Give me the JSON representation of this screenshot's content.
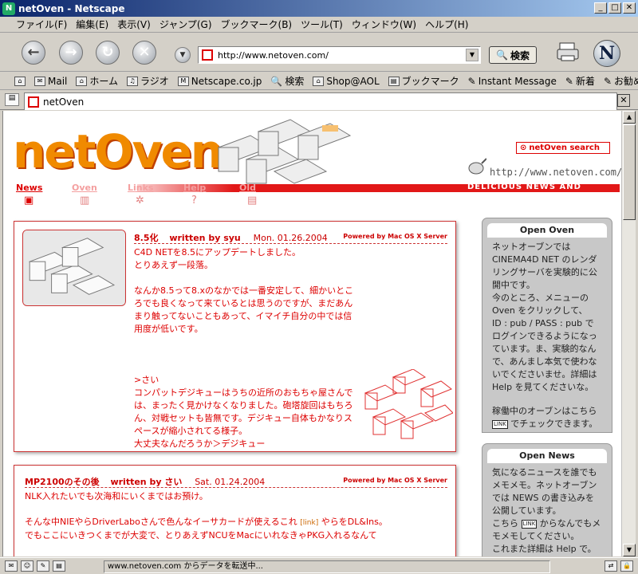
{
  "window": {
    "title": "netOven - Netscape"
  },
  "menubar": [
    "ファイル(F)",
    "編集(E)",
    "表示(V)",
    "ジャンプ(G)",
    "ブックマーク(B)",
    "ツール(T)",
    "ウィンドウ(W)",
    "ヘルプ(H)"
  ],
  "navbar": {
    "url": "http://www.netoven.com/",
    "search_label": "検索"
  },
  "personal_toolbar": [
    "Mail",
    "ホーム",
    "ラジオ",
    "Netscape.co.jp",
    "検索",
    "Shop@AOL",
    "ブックマーク",
    "Instant Message",
    "新着",
    "お勧め"
  ],
  "tab": {
    "label": "netOven"
  },
  "site": {
    "logo": "netOven",
    "search_label": "netOven search",
    "url_text": "http://www.netoven.com/",
    "tagline": "DELICIOUS NEWS AND RENDERING",
    "nav": [
      "News",
      "Oven",
      "Links",
      "Help",
      "Old"
    ]
  },
  "posts": [
    {
      "title": "8.5化",
      "author": "written by syu",
      "date": "Mon. 01.26.2004",
      "powered": "Powered by Mac OS X Server",
      "paragraphs": [
        "C4D NETを8.5にアップデートしました。\nとりあえず一段落。",
        "なんか8.5って8.xのなかでは一番安定して、細かいところでも良くなって来ているとは思うのですが、まだあんまり触ってないこともあって、イマイチ自分の中では信用度が低いです。",
        "",
        ">さい\nコンパットデジキューはうちの近所のおもちゃ屋さんでは、まったく見かけなくなりました。砲塔旋回はもちろん、対戦セットも皆無です。デジキュー自体もかなりスペースが縮小されてる様子。\n大丈夫なんだろうか＞デジキュー"
      ]
    },
    {
      "title": "MP2100のその後",
      "author": "written by さい",
      "date": "Sat. 01.24.2004",
      "powered": "Powered by Mac OS X Server",
      "p1": "NLK入れたいでも次海和にいくまではお預け。",
      "p2_before": "そんな中NIEやらDriverLaboさんで色んなイーサカードが使えるこれ",
      "p2_link": "[link]",
      "p2_after": "やらをDL&Ins。",
      "p3": "でもここにいきつくまでが大変で、とりあえずNCUをMacにいれなきゃPKG入れるなんて"
    }
  ],
  "sidebar": [
    {
      "title": "Open Oven",
      "line1": "ネットオーブンではCINEMA4D NET のレンダリングサーバを実験的に公開中です。",
      "line2": "今のところ、メニューのOven をクリックして、",
      "line3": "ID : pub / PASS : pub でログインできるようになっています。ま、実験的なんで、あんまし本気で使わないでくださいませ。詳細はHelp を見てくださいな。",
      "line4a": "稼働中のオーブンはこちら",
      "line4b": "でチェックできます。",
      "badge": "LINK"
    },
    {
      "title": "Open News",
      "line1": "気になるニュースを誰でもメモメモ。ネットオーブンでは NEWS の書き込みを公開しています。",
      "line2a": "こちら",
      "line2b": "からなんでもメモメモしてください。",
      "line3": "これまた詳細は Help で。",
      "badge": "LINK"
    }
  ],
  "status": {
    "text": "www.netoven.com からデータを転送中..."
  }
}
